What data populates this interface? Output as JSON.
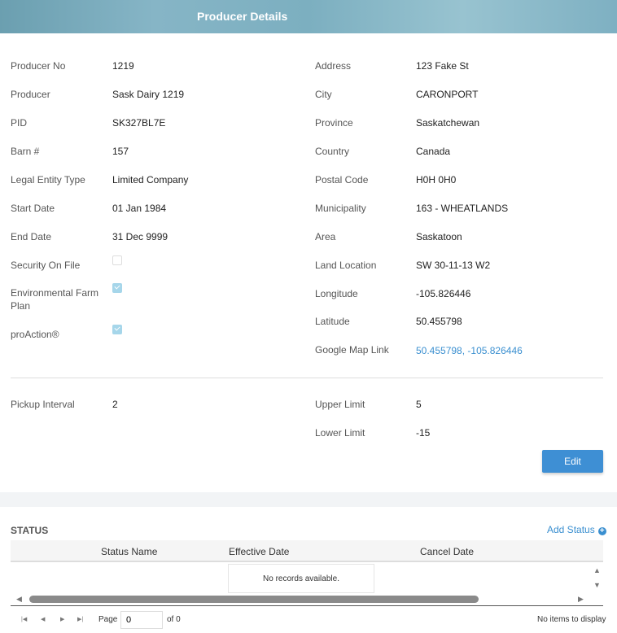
{
  "header": {
    "title": "Producer Details"
  },
  "left": [
    {
      "label": "Producer No",
      "value": "1219"
    },
    {
      "label": "Producer",
      "value": "Sask Dairy 1219"
    },
    {
      "label": "PID",
      "value": "SK327BL7E"
    },
    {
      "label": "Barn #",
      "value": "157"
    },
    {
      "label": "Legal Entity Type",
      "value": "Limited Company"
    },
    {
      "label": "Start Date",
      "value": "01 Jan 1984"
    },
    {
      "label": "End Date",
      "value": "31 Dec 9999"
    }
  ],
  "checks": [
    {
      "label": "Security On File",
      "checked": false
    },
    {
      "label": "Environmental Farm Plan",
      "checked": true
    },
    {
      "label": "proAction®",
      "checked": true
    }
  ],
  "right": [
    {
      "label": "Address",
      "value": "123 Fake St"
    },
    {
      "label": "City",
      "value": "CARONPORT"
    },
    {
      "label": "Province",
      "value": "Saskatchewan"
    },
    {
      "label": "Country",
      "value": "Canada"
    },
    {
      "label": "Postal Code",
      "value": "H0H 0H0"
    },
    {
      "label": "Municipality",
      "value": "163 - WHEATLANDS"
    },
    {
      "label": "Area",
      "value": "Saskatoon"
    },
    {
      "label": "Land Location",
      "value": "SW 30-11-13 W2"
    },
    {
      "label": "Longitude",
      "value": "-105.826446"
    },
    {
      "label": "Latitude",
      "value": "50.455798"
    },
    {
      "label": "Google Map Link",
      "value": "50.455798, -105.826446"
    }
  ],
  "limits": {
    "pickup_label": "Pickup Interval",
    "pickup": "2",
    "upper_label": "Upper Limit",
    "upper": "5",
    "lower_label": "Lower Limit",
    "lower": "-15"
  },
  "edit_label": "Edit",
  "status": {
    "title": "STATUS",
    "add_label": "Add Status",
    "columns": [
      "Status Name",
      "Effective Date",
      "Cancel Date"
    ],
    "empty": "No records available.",
    "page_label": "Page",
    "page": "0",
    "of": "of 0",
    "items": "No items to display"
  }
}
